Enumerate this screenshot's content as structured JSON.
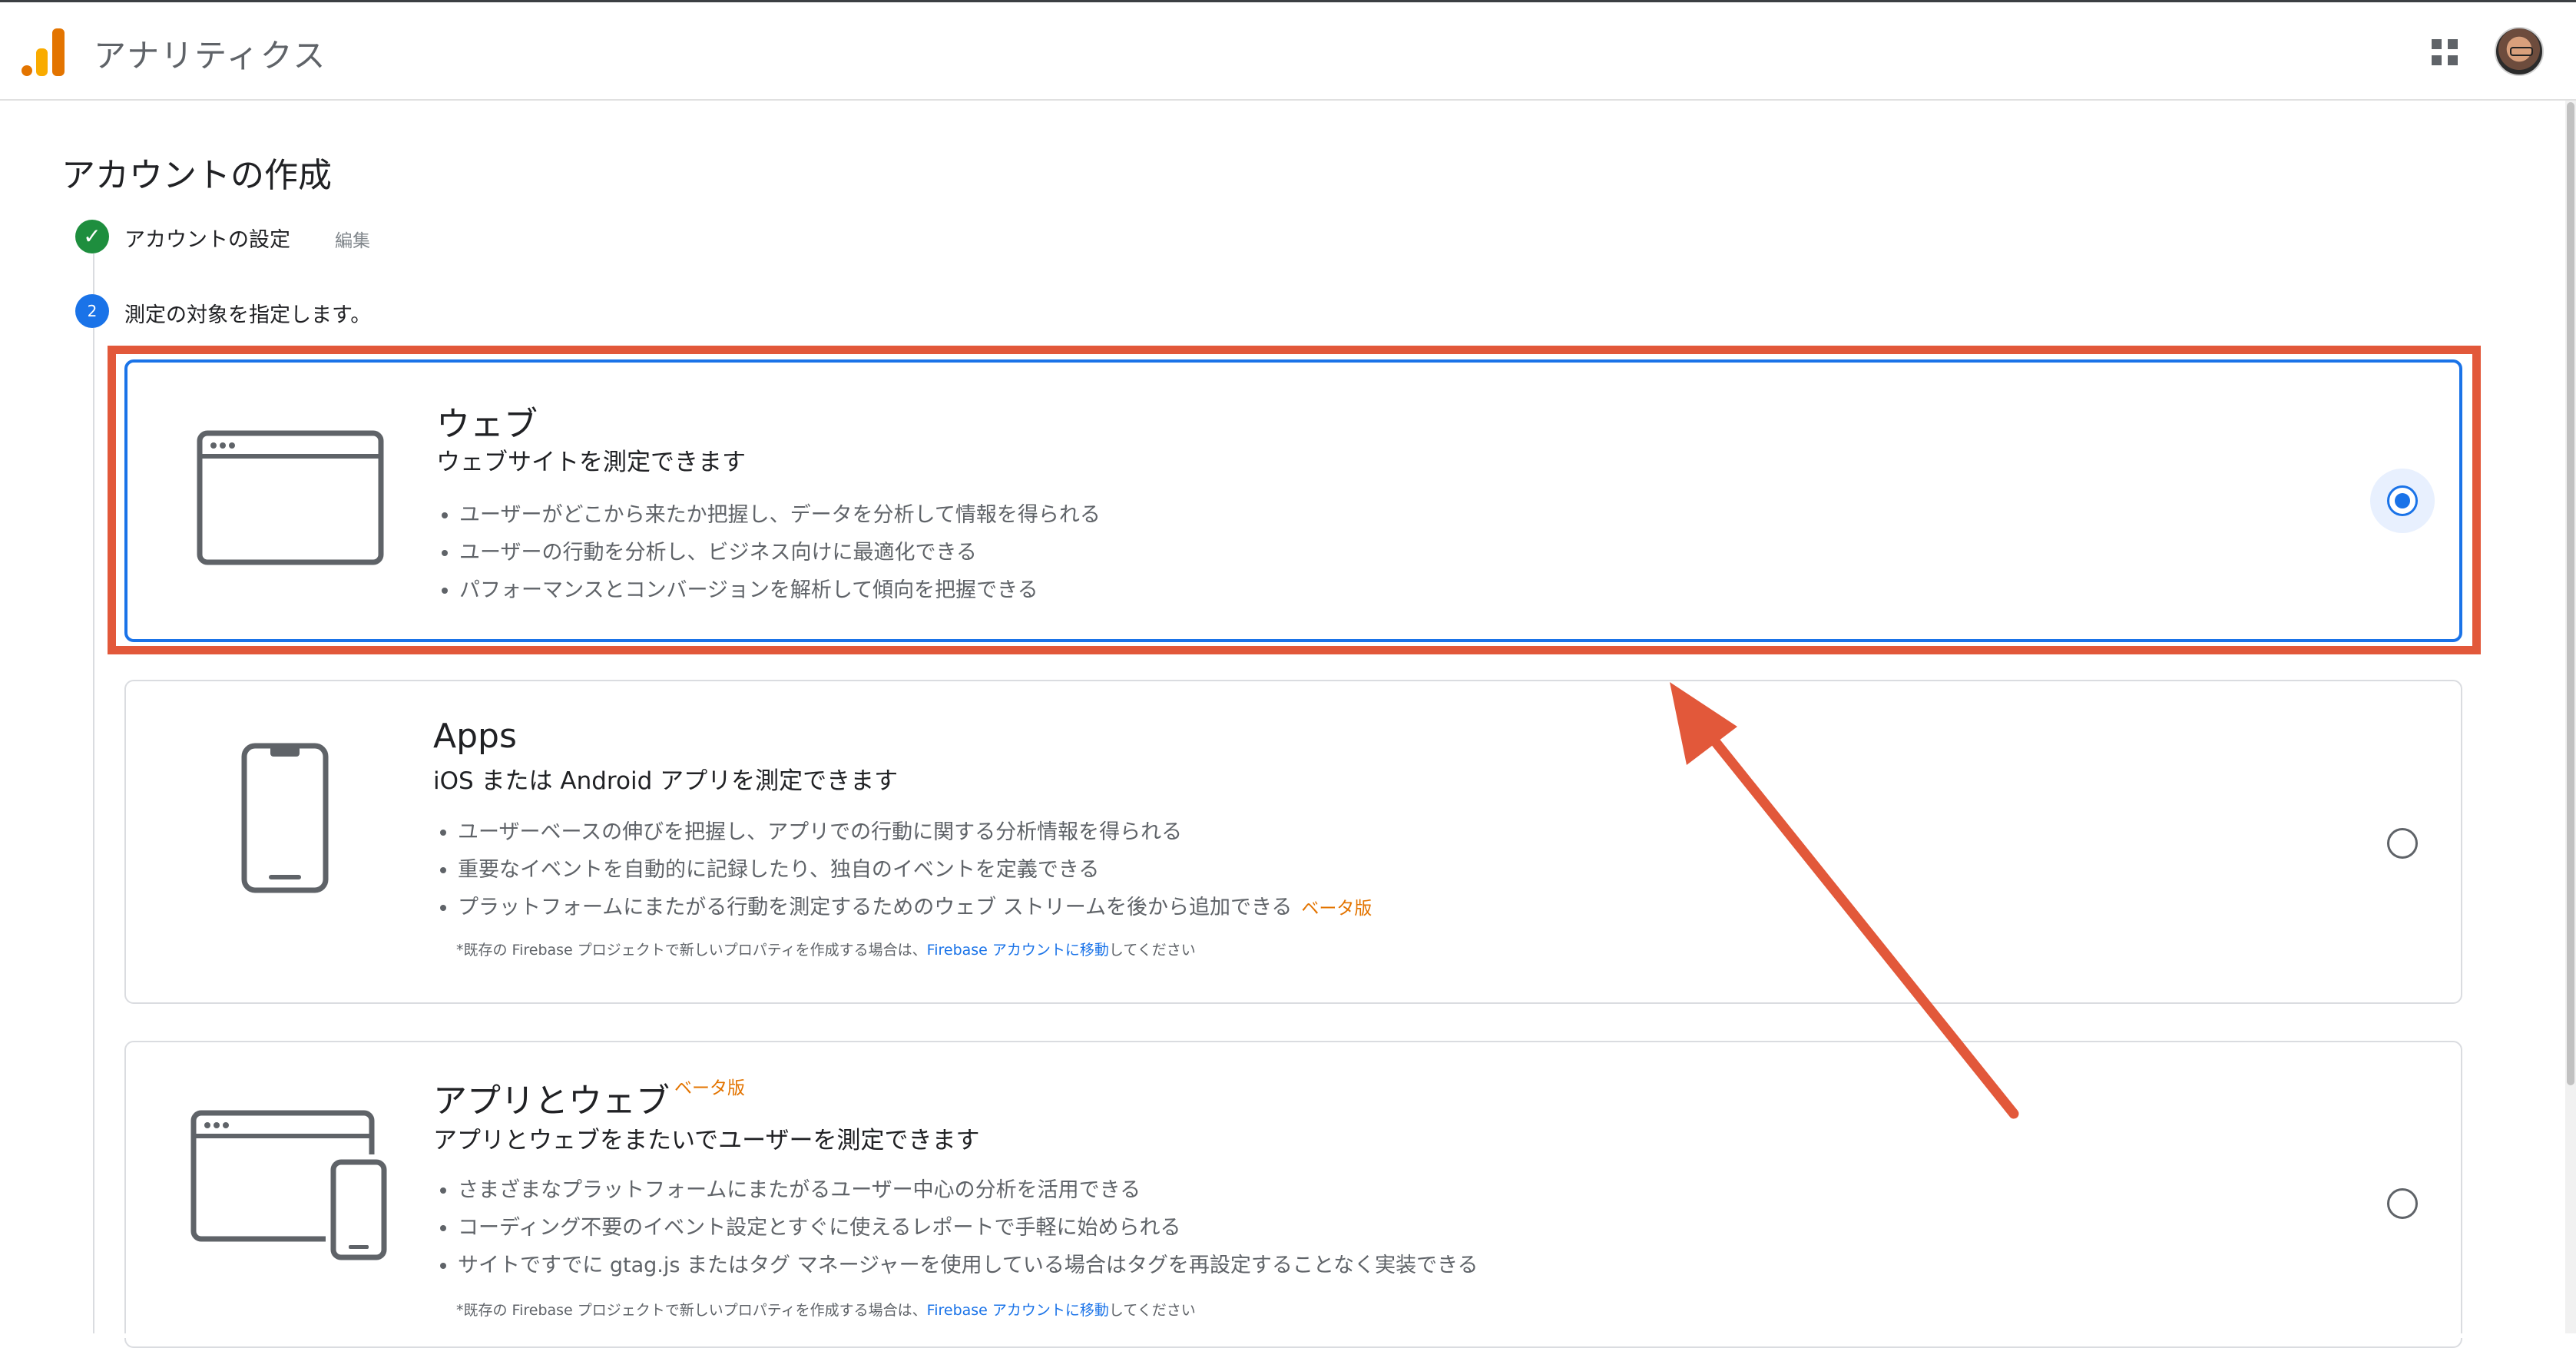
{
  "header": {
    "app_title": "アナリティクス",
    "apps_icon": "apps-grid-icon",
    "avatar": "user-avatar"
  },
  "page": {
    "title": "アカウントの作成"
  },
  "steps": [
    {
      "status": "done",
      "icon": "check-icon",
      "label": "アカウントの設定",
      "edit_label": "編集"
    },
    {
      "status": "active",
      "number": "2",
      "label": "測定の対象を指定します。"
    }
  ],
  "options": [
    {
      "id": "web",
      "icon": "web-browser-icon",
      "title": "ウェブ",
      "subtitle": "ウェブサイトを測定できます",
      "bullets": [
        "ユーザーがどこから来たか把握し、データを分析して情報を得られる",
        "ユーザーの行動を分析し、ビジネス向けに最適化できる",
        "パフォーマンスとコンバージョンを解析して傾向を把握できる"
      ],
      "selected": true
    },
    {
      "id": "apps",
      "icon": "mobile-phone-icon",
      "title": "Apps",
      "subtitle": "iOS または Android アプリを測定できます",
      "bullets": [
        "ユーザーベースの伸びを把握し、アプリでの行動に関する分析情報を得られる",
        "重要なイベントを自動的に記録したり、独自のイベントを定義できる",
        "プラットフォームにまたがる行動を測定するためのウェブ ストリームを後から追加できる"
      ],
      "beta_label": "ベータ版",
      "note_prefix": "*既存の Firebase プロジェクトで新しいプロパティを作成する場合は、",
      "note_link": "Firebase アカウントに移動",
      "note_suffix": "してください",
      "selected": false
    },
    {
      "id": "app_and_web",
      "icon": "browser-and-phone-icon",
      "title": "アプリとウェブ",
      "title_beta_label": "ベータ版",
      "subtitle": "アプリとウェブをまたいでユーザーを測定できます",
      "bullets": [
        "さまざまなプラットフォームにまたがるユーザー中心の分析を活用できる",
        "コーディング不要のイベント設定とすぐに使えるレポートで手軽に始められる",
        "サイトですでに gtag.js またはタグ マネージャーを使用している場合はタグを再設定することなく実装できる"
      ],
      "note_prefix": "*既存の Firebase プロジェクトで新しいプロパティを作成する場合は、",
      "note_link": "Firebase アカウントに移動",
      "note_suffix": "してください",
      "selected": false
    }
  ],
  "annotation": {
    "color": "#e2583a",
    "highlight": "web-option",
    "arrow": "points-to-web-option"
  },
  "colors": {
    "accent": "#1a73e8",
    "success": "#1e8e3e",
    "beta": "#e37400",
    "logo_orange": "#e37400",
    "logo_yellow": "#f9ab00"
  }
}
